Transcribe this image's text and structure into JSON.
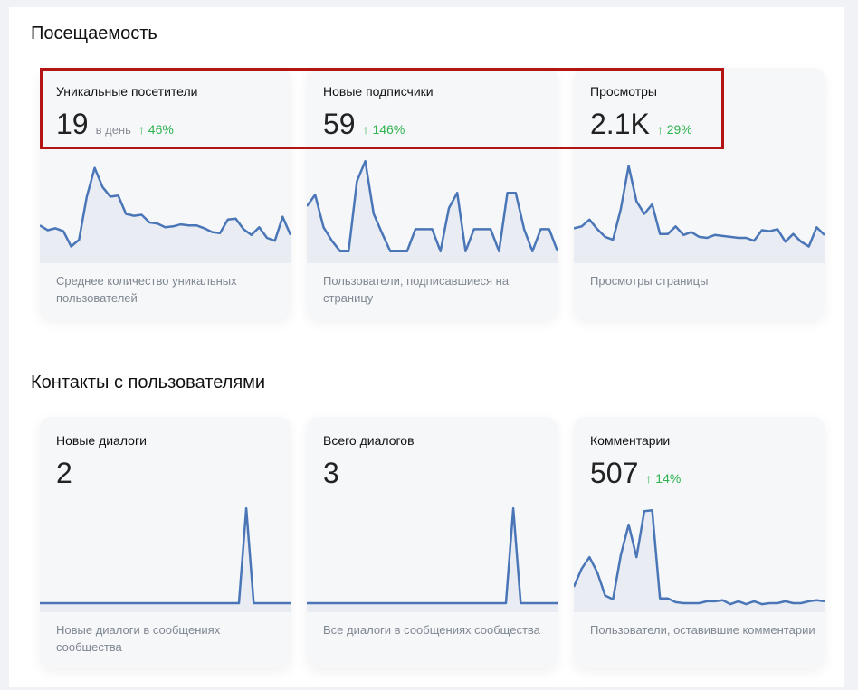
{
  "sections": {
    "attendance_title": "Посещаемость",
    "contacts_title": "Контакты с пользователями"
  },
  "cards": {
    "unique_visitors": {
      "title": "Уникальные посетители",
      "value": "19",
      "unit": "в день",
      "delta": "46%",
      "description": "Среднее количество уникальных пользователей"
    },
    "new_subscribers": {
      "title": "Новые подписчики",
      "value": "59",
      "delta": "146%",
      "description": "Пользователи, подписавшиеся на страницу"
    },
    "views": {
      "title": "Просмотры",
      "value": "2.1K",
      "delta": "29%",
      "description": "Просмотры страницы"
    },
    "new_dialogs": {
      "title": "Новые диалоги",
      "value": "2",
      "description": "Новые диалоги в сообщениях сообщества"
    },
    "total_dialogs": {
      "title": "Всего диалогов",
      "value": "3",
      "description": "Все диалоги в сообщениях сообщества"
    },
    "comments": {
      "title": "Комментарии",
      "value": "507",
      "delta": "14%",
      "description": "Пользователи, оставившие комментарии"
    }
  },
  "icons": {
    "trend_up": "arrow-up-icon"
  },
  "colors": {
    "line": "#4a76b8",
    "delta": "#2fb34f",
    "highlight": "#b31515"
  },
  "sparklines": {
    "unique_visitors": [
      0.3,
      0.25,
      0.27,
      0.24,
      0.08,
      0.15,
      0.6,
      0.9,
      0.7,
      0.6,
      0.61,
      0.42,
      0.4,
      0.41,
      0.33,
      0.32,
      0.28,
      0.29,
      0.31,
      0.3,
      0.3,
      0.27,
      0.23,
      0.22,
      0.36,
      0.37,
      0.26,
      0.2,
      0.28,
      0.17,
      0.14,
      0.39,
      0.2
    ],
    "new_subscribers": [
      0.5,
      0.62,
      0.28,
      0.14,
      0.03,
      0.03,
      0.76,
      0.97,
      0.42,
      0.22,
      0.03,
      0.03,
      0.03,
      0.26,
      0.26,
      0.26,
      0.03,
      0.48,
      0.64,
      0.03,
      0.26,
      0.26,
      0.26,
      0.03,
      0.64,
      0.64,
      0.26,
      0.03,
      0.26,
      0.26,
      0.03
    ],
    "views": [
      0.27,
      0.29,
      0.36,
      0.26,
      0.18,
      0.15,
      0.47,
      0.92,
      0.55,
      0.42,
      0.52,
      0.21,
      0.21,
      0.29,
      0.2,
      0.23,
      0.18,
      0.17,
      0.2,
      0.19,
      0.18,
      0.17,
      0.17,
      0.14,
      0.25,
      0.24,
      0.26,
      0.13,
      0.21,
      0.13,
      0.08,
      0.28,
      0.2
    ],
    "new_dialogs": [
      0,
      0,
      0,
      0,
      0,
      0,
      0,
      0,
      0,
      0,
      0,
      0,
      0,
      0,
      0,
      0,
      0,
      0,
      0,
      0,
      0,
      0,
      0,
      0,
      0,
      0,
      0,
      0,
      0.99,
      0,
      0,
      0,
      0,
      0,
      0
    ],
    "total_dialogs": [
      0,
      0,
      0,
      0,
      0,
      0,
      0,
      0,
      0,
      0,
      0,
      0,
      0,
      0,
      0,
      0,
      0,
      0,
      0,
      0,
      0,
      0,
      0,
      0,
      0,
      0,
      0,
      0,
      0.99,
      0,
      0,
      0,
      0,
      0,
      0
    ],
    "comments": [
      0.17,
      0.36,
      0.48,
      0.32,
      0.08,
      0.04,
      0.5,
      0.82,
      0.48,
      0.96,
      0.97,
      0.05,
      0.05,
      0.01,
      0,
      0,
      0,
      0.02,
      0.02,
      0.03,
      -0.01,
      0.02,
      -0.01,
      0.02,
      -0.01,
      0,
      0,
      0.02,
      0,
      0,
      0.02,
      0.03,
      0.02
    ]
  }
}
